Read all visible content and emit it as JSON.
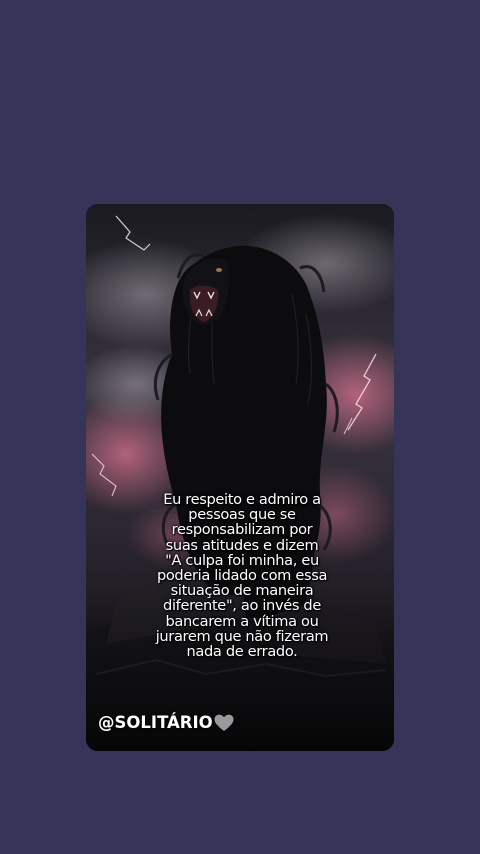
{
  "story": {
    "image_subject": "black-lion-icon",
    "quote_lines": [
      "Eu respeito e admiro a",
      "pessoas que se",
      "responsabilizam por",
      "suas atitudes e dizem",
      "\"A culpa foi minha, eu",
      "poderia lidado com essa",
      "situação de maneira",
      "diferente\", ao invés de",
      "bancarem a vítima ou",
      "jurarem que não fizeram",
      "nada de errado."
    ],
    "handle": "@SOLITÁRIO",
    "handle_icon": "gray-heart-icon"
  },
  "colors": {
    "page_background": "#37345a",
    "text": "#ffffff",
    "heart": "#9a9a9e"
  }
}
